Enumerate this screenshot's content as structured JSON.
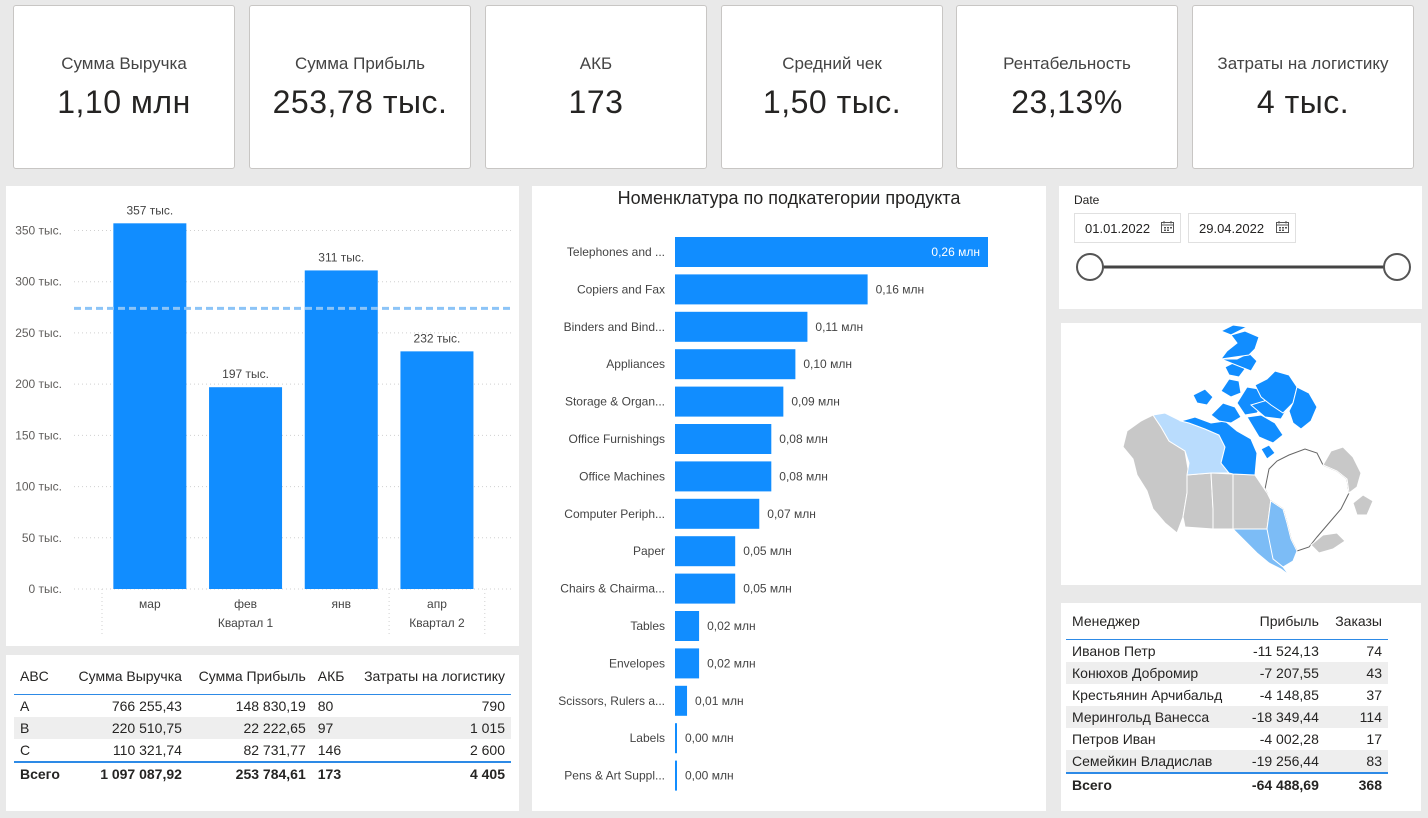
{
  "kpis": [
    {
      "title": "Сумма Выручка",
      "value": "1,10 млн"
    },
    {
      "title": "Сумма Прибыль",
      "value": "253,78 тыс."
    },
    {
      "title": "АКБ",
      "value": "173"
    },
    {
      "title": "Средний чек",
      "value": "1,50 тыс."
    },
    {
      "title": "Рентабельность",
      "value": "23,13%"
    },
    {
      "title": "Затраты на логистику",
      "value": "4 тыс."
    }
  ],
  "chart_data": [
    {
      "type": "bar",
      "title": "",
      "categories": [
        "мар",
        "фев",
        "янв",
        "апр"
      ],
      "groups": [
        "Квартал 1",
        "Квартал 2"
      ],
      "values": [
        357,
        197,
        311,
        232
      ],
      "data_labels": [
        "357 тыс.",
        "197 тыс.",
        "311 тыс.",
        "232 тыс."
      ],
      "y_ticks": [
        "0 тыс.",
        "50 тыс.",
        "100 тыс.",
        "150 тыс.",
        "200 тыс.",
        "250 тыс.",
        "300 тыс.",
        "350 тыс."
      ],
      "reference_line": 274,
      "ylim": [
        0,
        370
      ],
      "color": "#118dff",
      "grid": true
    },
    {
      "type": "bar",
      "orientation": "horizontal",
      "title": "Номенклатура по подкатегории продукта",
      "categories": [
        "Telephones and ...",
        "Copiers and Fax",
        "Binders and Bind...",
        "Appliances",
        "Storage & Organ...",
        "Office Furnishings",
        "Office Machines",
        "Computer Periph...",
        "Paper",
        "Chairs & Chairma...",
        "Tables",
        "Envelopes",
        "Scissors, Rulers a...",
        "Labels",
        "Pens & Art Suppl..."
      ],
      "values": [
        0.26,
        0.16,
        0.11,
        0.1,
        0.09,
        0.08,
        0.08,
        0.07,
        0.05,
        0.05,
        0.02,
        0.02,
        0.01,
        0.0,
        0.0
      ],
      "data_labels": [
        "0,26 млн",
        "0,16 млн",
        "0,11 млн",
        "0,10 млн",
        "0,09 млн",
        "0,08 млн",
        "0,08 млн",
        "0,07 млн",
        "0,05 млн",
        "0,05 млн",
        "0,02 млн",
        "0,02 млн",
        "0,01 млн",
        "0,00 млн",
        "0,00 млн"
      ],
      "xlim": [
        0,
        0.26
      ],
      "color": "#118dff"
    }
  ],
  "abc_table": {
    "headers": [
      "ABC",
      "Сумма Выручка",
      "Сумма Прибыль",
      "АКБ",
      "Затраты на логистику"
    ],
    "rows": [
      [
        "A",
        "766 255,43",
        "148 830,19",
        "80",
        "790"
      ],
      [
        "B",
        "220 510,75",
        "22 222,65",
        "97",
        "1 015"
      ],
      [
        "C",
        "110 321,74",
        "82 731,77",
        "146",
        "2 600"
      ]
    ],
    "total": [
      "Всего",
      "1 097 087,92",
      "253 784,61",
      "173",
      "4 405"
    ]
  },
  "date_filter": {
    "label": "Date",
    "start": "01.01.2022",
    "end": "29.04.2022"
  },
  "map": {
    "region": "Canada",
    "colors": {
      "dark": "#118dff",
      "light": "#b9dcfd",
      "mid": "#7cbcf6",
      "gray": "#c8c8c8"
    }
  },
  "manager_table": {
    "headers": [
      "Менеджер",
      "Прибыль",
      "Заказы"
    ],
    "rows": [
      [
        "Иванов Петр",
        "-11 524,13",
        "74"
      ],
      [
        "Конюхов Добромир",
        "-7 207,55",
        "43"
      ],
      [
        "Крестьянин Арчибальд",
        "-4 148,85",
        "37"
      ],
      [
        "Мерингольд Ванесса",
        "-18 349,44",
        "114"
      ],
      [
        "Петров Иван",
        "-4 002,28",
        "17"
      ],
      [
        "Семейкин Владислав",
        "-19 256,44",
        "83"
      ]
    ],
    "total": [
      "Всего",
      "-64 488,69",
      "368"
    ]
  }
}
